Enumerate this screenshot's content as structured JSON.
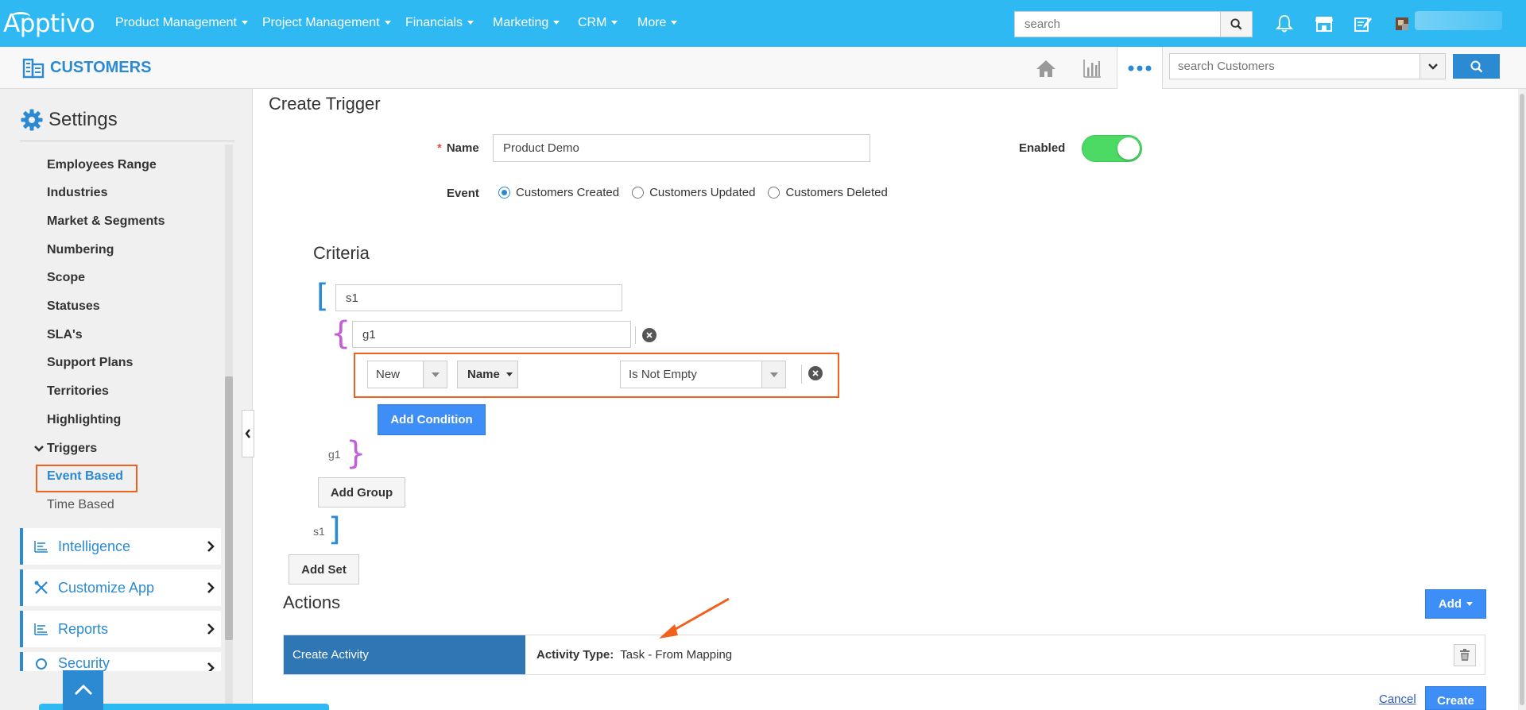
{
  "topbar": {
    "logo": "Apptivo",
    "nav": [
      "Product Management",
      "Project Management",
      "Financials",
      "Marketing",
      "CRM",
      "More"
    ],
    "search_placeholder": "search"
  },
  "subbar": {
    "app_title": "CUSTOMERS",
    "search_placeholder": "search Customers"
  },
  "sidebar": {
    "heading": "Settings",
    "items": [
      "Employees Range",
      "Industries",
      "Market & Segments",
      "Numbering",
      "Scope",
      "Statuses",
      "SLA's",
      "Support Plans",
      "Territories",
      "Highlighting"
    ],
    "triggers_label": "Triggers",
    "event_based": "Event Based",
    "time_based": "Time Based",
    "sections": [
      "Intelligence",
      "Customize App",
      "Reports",
      "Security"
    ]
  },
  "form": {
    "title": "Create Trigger",
    "name_label": "Name",
    "name_value": "Product Demo",
    "enabled_label": "Enabled",
    "enabled": true,
    "event_label": "Event",
    "events": [
      "Customers Created",
      "Customers Updated",
      "Customers Deleted"
    ],
    "selected_event": "Customers Created"
  },
  "criteria": {
    "title": "Criteria",
    "set_value": "s1",
    "group_value": "g1",
    "condition": {
      "prefix": "New",
      "field": "Name",
      "operator": "Is Not Empty"
    },
    "add_condition": "Add Condition",
    "group_close_label": "g1",
    "add_group": "Add Group",
    "set_close_label": "s1",
    "add_set": "Add Set"
  },
  "actions": {
    "title": "Actions",
    "add_label": "Add",
    "rows": [
      {
        "name": "Create Activity",
        "detail_label": "Activity Type:",
        "detail_value": "Task - From Mapping"
      }
    ],
    "cancel": "Cancel",
    "create": "Create"
  },
  "colors": {
    "topbar": "#2eb9f2",
    "accent": "#2b8ad1",
    "highlight_border": "#f1601d",
    "toggle_on": "#4cd964"
  }
}
